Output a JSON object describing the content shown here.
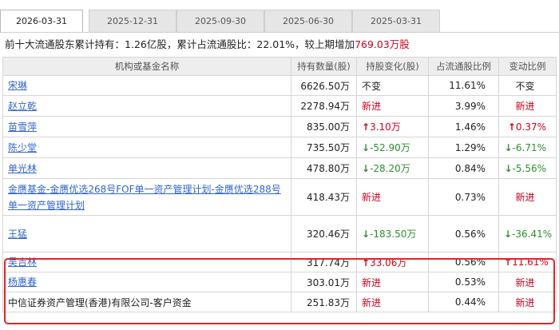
{
  "tabs": [
    {
      "label": "2026-03-31",
      "active": true
    },
    {
      "label": "2025-12-31",
      "active": false
    },
    {
      "label": "2025-09-30",
      "active": false
    },
    {
      "label": "2025-06-30",
      "active": false
    },
    {
      "label": "2025-03-31",
      "active": false
    }
  ],
  "summary": {
    "prefix": "前十大流通股东累计持有：",
    "total": "1.26亿股",
    "mid": "，累计占流通股比：",
    "ratio": "22.01%",
    "mid2": "，较上期增加",
    "increase": "769.03万股"
  },
  "table": {
    "headers": [
      "机构或基金名称",
      "持有数量(股)",
      "持股变化(股)",
      "占流通股比例",
      "变动比例"
    ],
    "rows": [
      {
        "name": "宋琳",
        "link": true,
        "shares": "6626.50万",
        "change": "不变",
        "change_type": "neutral",
        "ratio": "11.61%",
        "var": "不变",
        "var_type": "neutral"
      },
      {
        "name": "赵立乾",
        "link": true,
        "shares": "2278.94万",
        "change": "新进",
        "change_type": "new",
        "ratio": "3.99%",
        "var": "新进",
        "var_type": "new"
      },
      {
        "name": "苗雪萍",
        "link": true,
        "shares": "835.00万",
        "change": "3.10万",
        "change_type": "up",
        "ratio": "1.46%",
        "var": "0.37%",
        "var_type": "up"
      },
      {
        "name": "陈少堂",
        "link": true,
        "shares": "735.50万",
        "change": "-52.90万",
        "change_type": "down",
        "ratio": "1.29%",
        "var": "-6.71%",
        "var_type": "down"
      },
      {
        "name": "单光林",
        "link": true,
        "shares": "478.80万",
        "change": "-28.20万",
        "change_type": "down",
        "ratio": "0.84%",
        "var": "-5.56%",
        "var_type": "down"
      },
      {
        "name": "金赝基金-金赝优选268号FOF单一资产管理计划-金赝优选288号单一资产管理计划",
        "link": true,
        "shares": "418.43万",
        "change": "新进",
        "change_type": "new",
        "ratio": "0.73%",
        "var": "新进",
        "var_type": "new"
      },
      {
        "name": "王猛",
        "link": true,
        "shares": "320.46万",
        "change": "-183.50万",
        "change_type": "down",
        "ratio": "0.56%",
        "var": "-36.41%",
        "var_type": "down"
      },
      {
        "name": "吴吉林",
        "link": true,
        "shares": "317.74万",
        "change": "33.06万",
        "change_type": "up",
        "ratio": "0.56%",
        "var": "11.61%",
        "var_type": "up"
      },
      {
        "name": "杨惠春",
        "link": true,
        "shares": "303.01万",
        "change": "新进",
        "change_type": "new",
        "ratio": "0.53%",
        "var": "新进",
        "var_type": "new"
      },
      {
        "name": "中信证券资产管理(香港)有限公司-客户资金",
        "link": false,
        "shares": "251.83万",
        "change": "新进",
        "change_type": "new",
        "ratio": "0.44%",
        "var": "新进",
        "var_type": "new"
      }
    ]
  },
  "colors": {
    "red": "#d0021b",
    "green": "#2f8f2f",
    "link": "#3366cc",
    "highlight": "#e0262b"
  },
  "icons": {
    "up": "arrow-up-icon",
    "down": "arrow-down-icon"
  }
}
